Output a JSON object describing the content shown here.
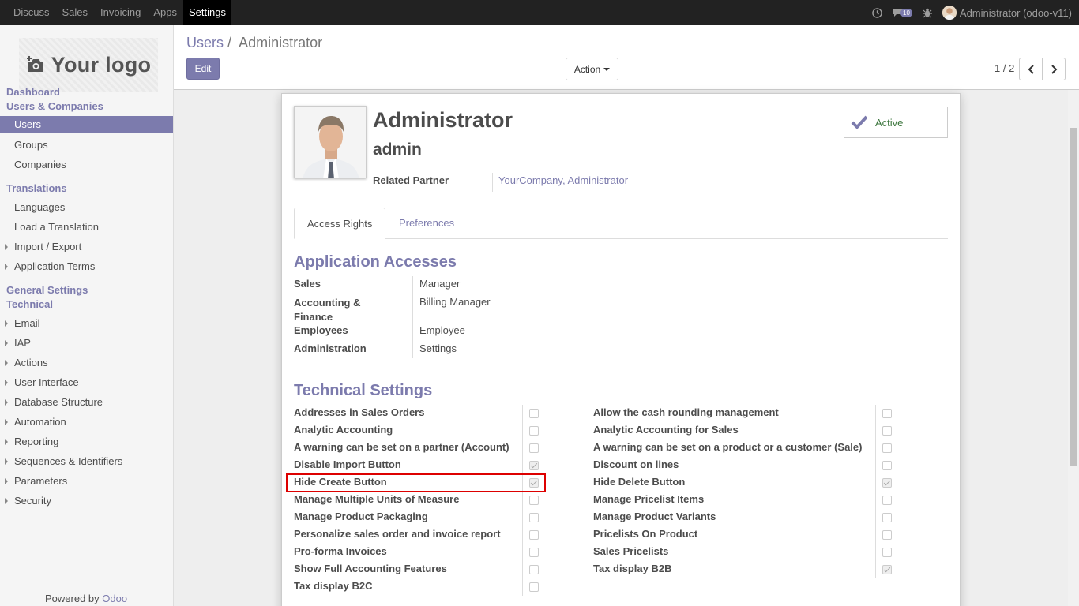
{
  "topbar": {
    "menu": [
      "Discuss",
      "Sales",
      "Invoicing",
      "Apps",
      "Settings"
    ],
    "active_menu": "Settings",
    "chat_count": "10",
    "user": "Administrator (odoo-v11)"
  },
  "sidebar": {
    "logo": "Your logo",
    "sections": [
      {
        "title": "Dashboard"
      },
      {
        "title": "Users & Companies",
        "items": [
          "Users",
          "Groups",
          "Companies"
        ]
      },
      {
        "title": "Translations",
        "items": [
          "Languages",
          "Load a Translation",
          "Import / Export",
          "Application Terms"
        ]
      },
      {
        "title": "General Settings"
      },
      {
        "title": "Technical",
        "items": [
          "Email",
          "IAP",
          "Actions",
          "User Interface",
          "Database Structure",
          "Automation",
          "Reporting",
          "Sequences & Identifiers",
          "Parameters",
          "Security"
        ]
      }
    ],
    "active_item": "Users",
    "powered_by": "Powered by",
    "powered_brand": "Odoo"
  },
  "control_panel": {
    "breadcrumb_parent": "Users",
    "breadcrumb_sep": "/",
    "breadcrumb_current": "Administrator",
    "edit_label": "Edit",
    "action_label": "Action",
    "pager": "1 / 2"
  },
  "record": {
    "name": "Administrator",
    "login": "admin",
    "related_partner_label": "Related Partner",
    "related_partner_value": "YourCompany, Administrator",
    "active_label": "Active"
  },
  "tabs": [
    "Access Rights",
    "Preferences"
  ],
  "app_access": {
    "title": "Application Accesses",
    "rows": [
      {
        "label": "Sales",
        "value": "Manager"
      },
      {
        "label": "Accounting & Finance",
        "value": "Billing Manager"
      },
      {
        "label": "Employees",
        "value": "Employee"
      },
      {
        "label": "Administration",
        "value": "Settings"
      }
    ]
  },
  "tech": {
    "title": "Technical Settings",
    "left": [
      {
        "label": "Addresses in Sales Orders",
        "checked": false
      },
      {
        "label": "Analytic Accounting",
        "checked": false
      },
      {
        "label": "A warning can be set on a partner (Account)",
        "checked": false
      },
      {
        "label": "Disable Import Button",
        "checked": true
      },
      {
        "label": "Hide Create Button",
        "checked": true
      },
      {
        "label": "Manage Multiple Units of Measure",
        "checked": false
      },
      {
        "label": "Manage Product Packaging",
        "checked": false
      },
      {
        "label": "Personalize sales order and invoice report",
        "checked": false
      },
      {
        "label": "Pro-forma Invoices",
        "checked": false
      },
      {
        "label": "Show Full Accounting Features",
        "checked": false
      },
      {
        "label": "Tax display B2C",
        "checked": false
      }
    ],
    "right": [
      {
        "label": "Allow the cash rounding management",
        "checked": false
      },
      {
        "label": "Analytic Accounting for Sales",
        "checked": false
      },
      {
        "label": "A warning can be set on a product or a customer (Sale)",
        "checked": false
      },
      {
        "label": "Discount on lines",
        "checked": false
      },
      {
        "label": "Hide Delete Button",
        "checked": true
      },
      {
        "label": "Manage Pricelist Items",
        "checked": false
      },
      {
        "label": "Manage Product Variants",
        "checked": false
      },
      {
        "label": "Pricelists On Product",
        "checked": false
      },
      {
        "label": "Sales Pricelists",
        "checked": false
      },
      {
        "label": "Tax display B2B",
        "checked": true
      }
    ]
  }
}
